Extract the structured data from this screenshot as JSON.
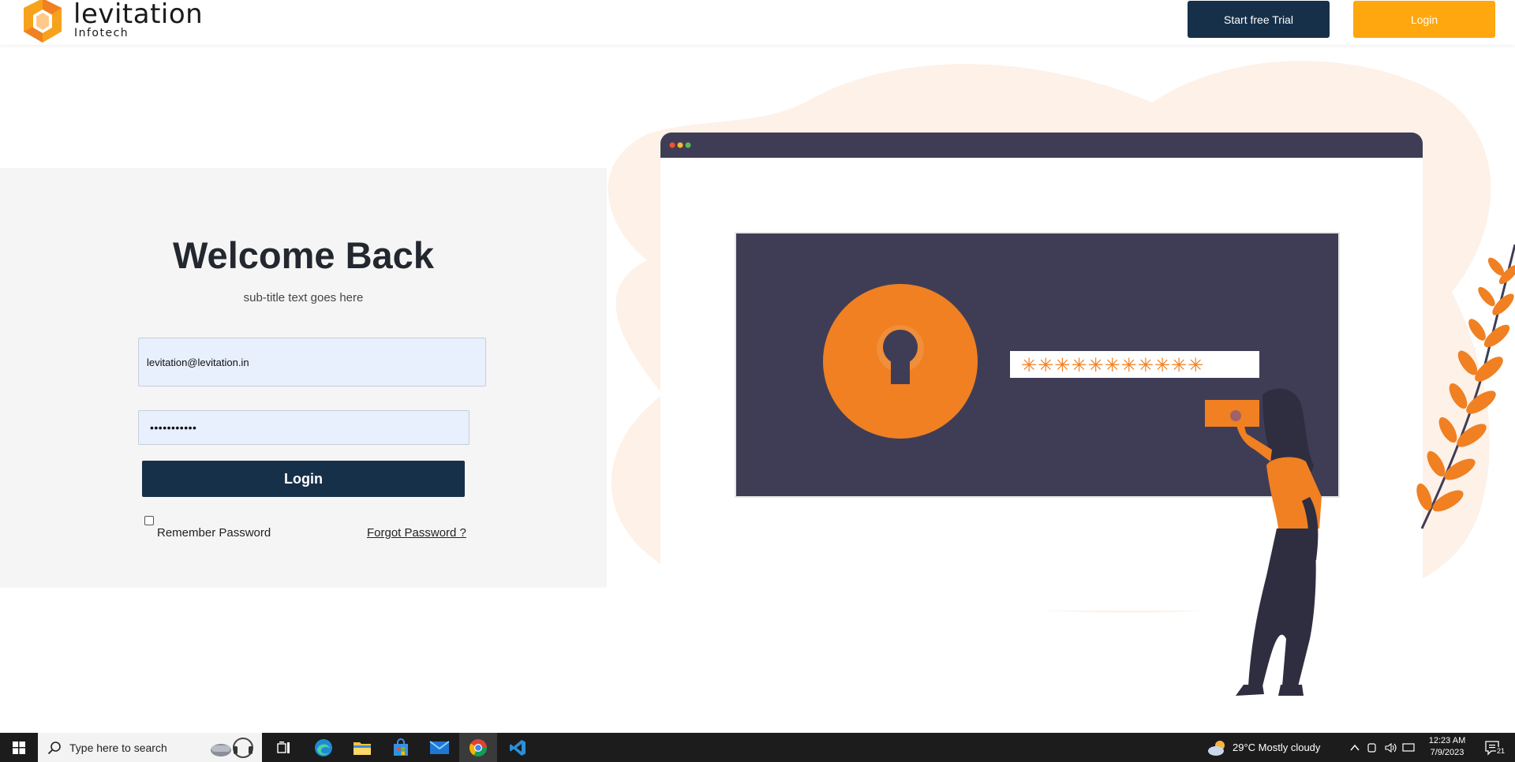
{
  "header": {
    "brand_name": "levitation",
    "brand_sub": "Infotech",
    "trial_button": "Start free Trial",
    "login_button": "Login"
  },
  "login": {
    "title": "Welcome Back",
    "subtitle": "sub-title text goes here",
    "email_value": "levitation@levitation.in",
    "password_value": "•••••••••••",
    "submit_button": "Login",
    "remember_label": "Remember Password",
    "forgot_link": "Forgot Password ?"
  },
  "illustration": {
    "password_mask": "✳✳✳✳✳✳✳✳✳✳✳"
  },
  "taskbar": {
    "search_placeholder": "Type here to search",
    "weather": "29°C  Mostly cloudy",
    "time": "12:23 AM",
    "date": "7/9/2023",
    "notification_count": "21"
  },
  "colors": {
    "navy": "#17304a",
    "orange": "#ffa70f",
    "illustration_orange": "#f08022",
    "illustration_dark": "#3f3d56",
    "blob": "#fdf1e8"
  },
  "icons": [
    "logo-hexagon-icon",
    "windows-start-icon",
    "search-icon",
    "task-view-icon",
    "edge-icon",
    "file-explorer-icon",
    "store-icon",
    "mail-icon",
    "chrome-icon",
    "vscode-icon",
    "weather-cloud-icon",
    "chevron-up-icon",
    "network-icon",
    "volume-icon",
    "notification-icon"
  ]
}
